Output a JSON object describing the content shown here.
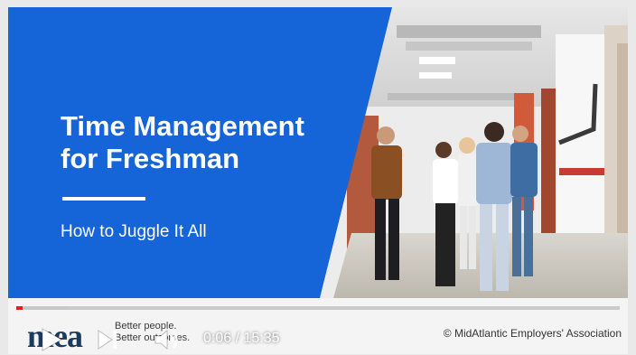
{
  "slide": {
    "title_line1": "Time Management",
    "title_line2": "for Freshman",
    "subtitle": "How to Juggle It All"
  },
  "footer": {
    "brand": "mea",
    "tagline_line1": "Better people.",
    "tagline_line2": "Better outcomes.",
    "copyright": "© MidAtlantic Employers' Association"
  },
  "player": {
    "time_display": "0:06 / 15:35",
    "current_time": "0:06",
    "duration": "15:35",
    "progress_fraction": 0.0064,
    "buffered_fraction": 0.085
  },
  "colors": {
    "slide_blue": "#1565d8",
    "progress_red": "#e02020",
    "brand_navy": "#1b3a5c"
  },
  "icons": [
    "play-icon",
    "next-icon",
    "volume-icon"
  ]
}
